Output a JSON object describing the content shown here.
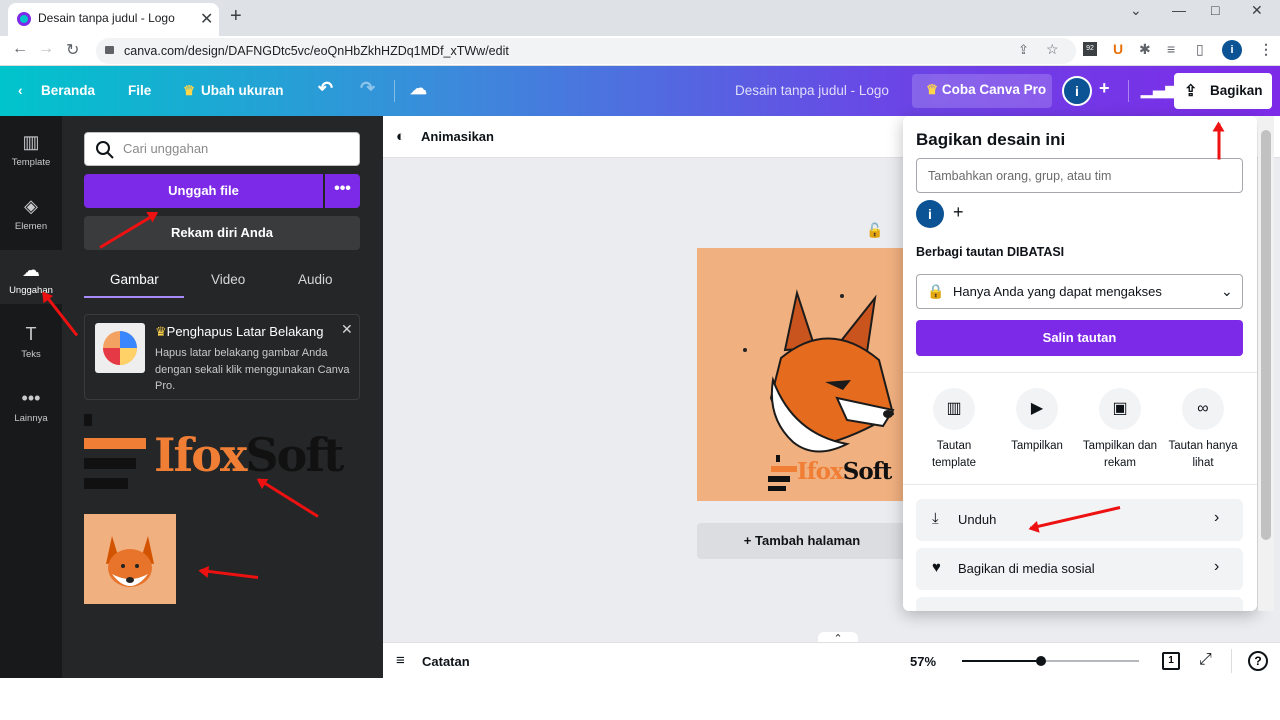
{
  "browser": {
    "tab_title": "Desain tanpa judul - Logo",
    "tab_close": "✕",
    "new_tab": "+",
    "url": "canva.com/design/DAFNGDtc5vc/eoQnHbZkhHZDq1MDf_xTWw/edit",
    "window_controls": [
      "⌄",
      "—",
      "□",
      "✕"
    ],
    "ext_badge": "92",
    "profile_initial": "i"
  },
  "topbar": {
    "home": "Beranda",
    "file": "File",
    "resize": "Ubah ukuran",
    "title": "Desain tanpa judul - Logo",
    "pro": "Coba Canva Pro",
    "avatar": "i",
    "share": "Bagikan"
  },
  "rail": [
    {
      "label": "Template",
      "icon": "▥"
    },
    {
      "label": "Elemen",
      "icon": "◈"
    },
    {
      "label": "Unggahan",
      "icon": "☁"
    },
    {
      "label": "Teks",
      "icon": "T"
    },
    {
      "label": "Lainnya",
      "icon": "•••"
    }
  ],
  "panel": {
    "search_placeholder": "Cari unggahan",
    "upload": "Unggah file",
    "more": "•••",
    "record": "Rekam diri Anda",
    "tabs": [
      "Gambar",
      "Video",
      "Audio"
    ],
    "promo_title": "Penghapus Latar Belakang",
    "promo_body": "Hapus latar belakang gambar Anda dengan sekali klik menggunakan Canva Pro.",
    "logo_text_a": "Ifox",
    "logo_text_b": "Soft"
  },
  "canvas": {
    "animate": "Animasikan",
    "add_page": "+ Tambah halaman",
    "logo_a": "Ifox",
    "logo_b": "Soft"
  },
  "bottom": {
    "notes": "Catatan",
    "zoom": "57%",
    "zoom_level": 0.57,
    "page": "1",
    "help": "?"
  },
  "share_popup": {
    "title": "Bagikan desain ini",
    "input_placeholder": "Tambahkan orang, grup, atau tim",
    "avatar": "i",
    "link_label": "Berbagi tautan DIBATASI",
    "access": "Hanya Anda yang dapat mengakses",
    "copy": "Salin tautan",
    "options": [
      {
        "label": "Tautan template",
        "icon": "▥"
      },
      {
        "label": "Tampilkan",
        "icon": "▶"
      },
      {
        "label": "Tampilkan dan rekam",
        "icon": "▣"
      },
      {
        "label": "Tautan hanya lihat",
        "icon": "∞"
      }
    ],
    "rows": [
      {
        "label": "Unduh",
        "icon": "⤓"
      },
      {
        "label": "Bagikan di media sosial",
        "icon": "♥"
      }
    ]
  },
  "colors": {
    "accent": "#7d2ae8",
    "teal": "#00c4cc",
    "canvas_bg": "#f0b07f",
    "arrow": "#e11111"
  }
}
